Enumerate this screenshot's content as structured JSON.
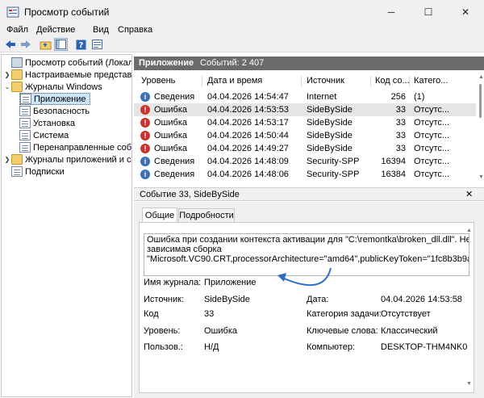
{
  "window": {
    "title": "Просмотр событий"
  },
  "menu": [
    "Файл",
    "Действие",
    "Вид",
    "Справка"
  ],
  "tree": {
    "root": "Просмотр событий (Локальн",
    "items": [
      "Настраиваемые представле",
      "Журналы Windows",
      "Приложение",
      "Безопасность",
      "Установка",
      "Система",
      "Перенаправленные собы",
      "Журналы приложений и сл",
      "Подписки"
    ]
  },
  "events_header": {
    "name": "Приложение",
    "count": "Событий: 2 407"
  },
  "columns": [
    "Уровень",
    "Дата и время",
    "Источник",
    "Код со...",
    "Катего..."
  ],
  "rows": [
    {
      "level": "Сведения",
      "level_type": "info",
      "date": "04.04.2026 14:54:47",
      "source": "Internet",
      "code": "256",
      "category": "(1)"
    },
    {
      "level": "Ошибка",
      "level_type": "error",
      "date": "04.04.2026 14:53:53",
      "source": "SideBySide",
      "code": "33",
      "category": "Отсутс..."
    },
    {
      "level": "Ошибка",
      "level_type": "error",
      "date": "04.04.2026 14:53:17",
      "source": "SideBySide",
      "code": "33",
      "category": "Отсутс..."
    },
    {
      "level": "Ошибка",
      "level_type": "error",
      "date": "04.04.2026 14:50:44",
      "source": "SideBySide",
      "code": "33",
      "category": "Отсутс..."
    },
    {
      "level": "Ошибка",
      "level_type": "error",
      "date": "04.04.2026 14:49:27",
      "source": "SideBySide",
      "code": "33",
      "category": "Отсутс..."
    },
    {
      "level": "Сведения",
      "level_type": "info",
      "date": "04.04.2026 14:48:09",
      "source": "Security-SPP",
      "code": "16394",
      "category": "Отсутс..."
    },
    {
      "level": "Сведения",
      "level_type": "info",
      "date": "04.04.2026 14:48:06",
      "source": "Security-SPP",
      "code": "16384",
      "category": "Отсутс..."
    }
  ],
  "detail": {
    "title": "Событие 33, SideBySide",
    "tabs": [
      "Общие",
      "Подробности"
    ],
    "message": [
      "Ошибка при создании контекста активации для \"C:\\remontka\\broken_dll.dll\". Не найде",
      "зависимая сборка",
      "\"Microsoft.VC90.CRT,processorArchitecture=\"amd64\",publicKeyToken=\"1fc8b3b9a1e18e3"
    ],
    "fields": {
      "log_name_label": "Имя журнала:",
      "log_name": "Приложение",
      "source_label": "Источник:",
      "source": "SideBySide",
      "date_label": "Дата:",
      "date": "04.04.2026 14:53:58",
      "code_label": "Код",
      "code": "33",
      "task_cat_label": "Категория задачи:",
      "task_cat": "Отсутствует",
      "level_label": "Уровень:",
      "level": "Ошибка",
      "keywords_label": "Ключевые слова:",
      "keywords": "Классический",
      "user_label": "Пользов.:",
      "user": "Н/Д",
      "computer_label": "Компьютер:",
      "computer": "DESKTOP-THM4NK0"
    }
  },
  "colors": {
    "accent_arrow": "#2a6fc0",
    "error": "#c9352a",
    "info": "#3c6fb6",
    "header_bg": "#6b6b6b"
  }
}
